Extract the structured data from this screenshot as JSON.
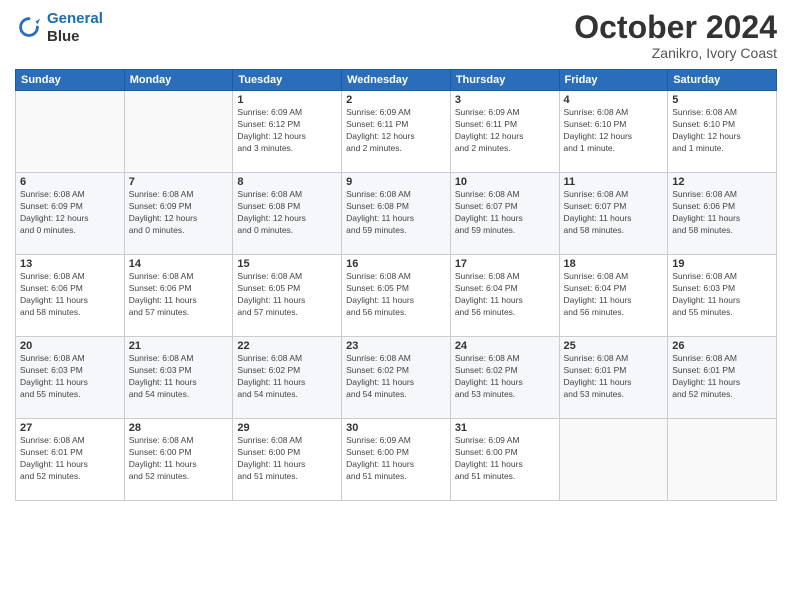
{
  "logo": {
    "line1": "General",
    "line2": "Blue"
  },
  "title": "October 2024",
  "location": "Zanikro, Ivory Coast",
  "days_header": [
    "Sunday",
    "Monday",
    "Tuesday",
    "Wednesday",
    "Thursday",
    "Friday",
    "Saturday"
  ],
  "weeks": [
    [
      {
        "day": "",
        "info": ""
      },
      {
        "day": "",
        "info": ""
      },
      {
        "day": "1",
        "info": "Sunrise: 6:09 AM\nSunset: 6:12 PM\nDaylight: 12 hours\nand 3 minutes."
      },
      {
        "day": "2",
        "info": "Sunrise: 6:09 AM\nSunset: 6:11 PM\nDaylight: 12 hours\nand 2 minutes."
      },
      {
        "day": "3",
        "info": "Sunrise: 6:09 AM\nSunset: 6:11 PM\nDaylight: 12 hours\nand 2 minutes."
      },
      {
        "day": "4",
        "info": "Sunrise: 6:08 AM\nSunset: 6:10 PM\nDaylight: 12 hours\nand 1 minute."
      },
      {
        "day": "5",
        "info": "Sunrise: 6:08 AM\nSunset: 6:10 PM\nDaylight: 12 hours\nand 1 minute."
      }
    ],
    [
      {
        "day": "6",
        "info": "Sunrise: 6:08 AM\nSunset: 6:09 PM\nDaylight: 12 hours\nand 0 minutes."
      },
      {
        "day": "7",
        "info": "Sunrise: 6:08 AM\nSunset: 6:09 PM\nDaylight: 12 hours\nand 0 minutes."
      },
      {
        "day": "8",
        "info": "Sunrise: 6:08 AM\nSunset: 6:08 PM\nDaylight: 12 hours\nand 0 minutes."
      },
      {
        "day": "9",
        "info": "Sunrise: 6:08 AM\nSunset: 6:08 PM\nDaylight: 11 hours\nand 59 minutes."
      },
      {
        "day": "10",
        "info": "Sunrise: 6:08 AM\nSunset: 6:07 PM\nDaylight: 11 hours\nand 59 minutes."
      },
      {
        "day": "11",
        "info": "Sunrise: 6:08 AM\nSunset: 6:07 PM\nDaylight: 11 hours\nand 58 minutes."
      },
      {
        "day": "12",
        "info": "Sunrise: 6:08 AM\nSunset: 6:06 PM\nDaylight: 11 hours\nand 58 minutes."
      }
    ],
    [
      {
        "day": "13",
        "info": "Sunrise: 6:08 AM\nSunset: 6:06 PM\nDaylight: 11 hours\nand 58 minutes."
      },
      {
        "day": "14",
        "info": "Sunrise: 6:08 AM\nSunset: 6:06 PM\nDaylight: 11 hours\nand 57 minutes."
      },
      {
        "day": "15",
        "info": "Sunrise: 6:08 AM\nSunset: 6:05 PM\nDaylight: 11 hours\nand 57 minutes."
      },
      {
        "day": "16",
        "info": "Sunrise: 6:08 AM\nSunset: 6:05 PM\nDaylight: 11 hours\nand 56 minutes."
      },
      {
        "day": "17",
        "info": "Sunrise: 6:08 AM\nSunset: 6:04 PM\nDaylight: 11 hours\nand 56 minutes."
      },
      {
        "day": "18",
        "info": "Sunrise: 6:08 AM\nSunset: 6:04 PM\nDaylight: 11 hours\nand 56 minutes."
      },
      {
        "day": "19",
        "info": "Sunrise: 6:08 AM\nSunset: 6:03 PM\nDaylight: 11 hours\nand 55 minutes."
      }
    ],
    [
      {
        "day": "20",
        "info": "Sunrise: 6:08 AM\nSunset: 6:03 PM\nDaylight: 11 hours\nand 55 minutes."
      },
      {
        "day": "21",
        "info": "Sunrise: 6:08 AM\nSunset: 6:03 PM\nDaylight: 11 hours\nand 54 minutes."
      },
      {
        "day": "22",
        "info": "Sunrise: 6:08 AM\nSunset: 6:02 PM\nDaylight: 11 hours\nand 54 minutes."
      },
      {
        "day": "23",
        "info": "Sunrise: 6:08 AM\nSunset: 6:02 PM\nDaylight: 11 hours\nand 54 minutes."
      },
      {
        "day": "24",
        "info": "Sunrise: 6:08 AM\nSunset: 6:02 PM\nDaylight: 11 hours\nand 53 minutes."
      },
      {
        "day": "25",
        "info": "Sunrise: 6:08 AM\nSunset: 6:01 PM\nDaylight: 11 hours\nand 53 minutes."
      },
      {
        "day": "26",
        "info": "Sunrise: 6:08 AM\nSunset: 6:01 PM\nDaylight: 11 hours\nand 52 minutes."
      }
    ],
    [
      {
        "day": "27",
        "info": "Sunrise: 6:08 AM\nSunset: 6:01 PM\nDaylight: 11 hours\nand 52 minutes."
      },
      {
        "day": "28",
        "info": "Sunrise: 6:08 AM\nSunset: 6:00 PM\nDaylight: 11 hours\nand 52 minutes."
      },
      {
        "day": "29",
        "info": "Sunrise: 6:08 AM\nSunset: 6:00 PM\nDaylight: 11 hours\nand 51 minutes."
      },
      {
        "day": "30",
        "info": "Sunrise: 6:09 AM\nSunset: 6:00 PM\nDaylight: 11 hours\nand 51 minutes."
      },
      {
        "day": "31",
        "info": "Sunrise: 6:09 AM\nSunset: 6:00 PM\nDaylight: 11 hours\nand 51 minutes."
      },
      {
        "day": "",
        "info": ""
      },
      {
        "day": "",
        "info": ""
      }
    ]
  ]
}
